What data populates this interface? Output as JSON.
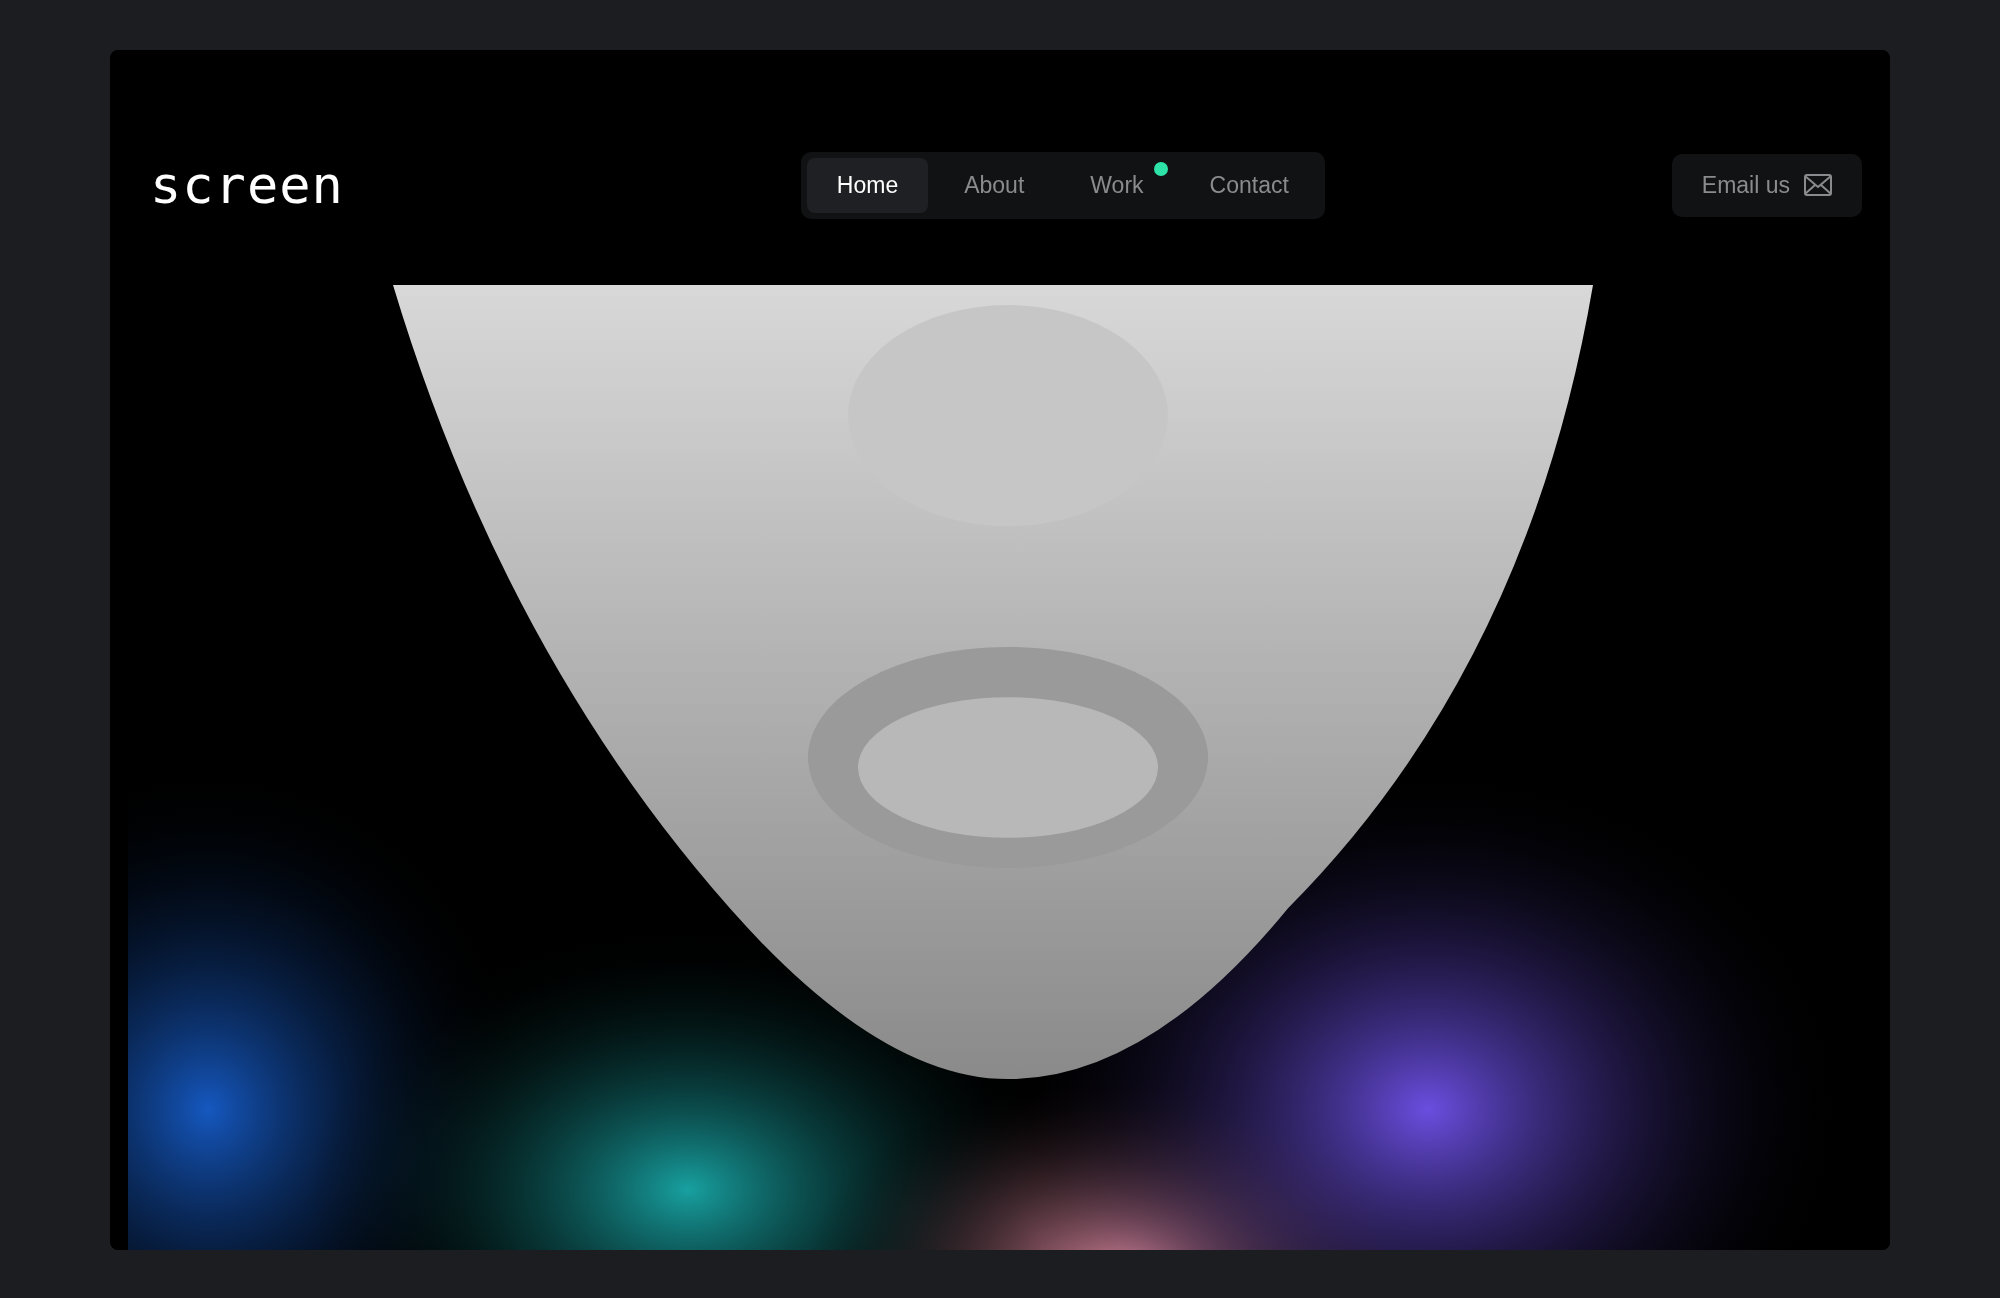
{
  "logo": "screen",
  "nav": [
    {
      "label": "Home",
      "selected": true,
      "has_dot": false
    },
    {
      "label": "About",
      "selected": false,
      "has_dot": false
    },
    {
      "label": "Work",
      "selected": false,
      "has_dot": true
    },
    {
      "label": "Contact",
      "selected": false,
      "has_dot": false
    }
  ],
  "cta": {
    "label": "Email us"
  }
}
